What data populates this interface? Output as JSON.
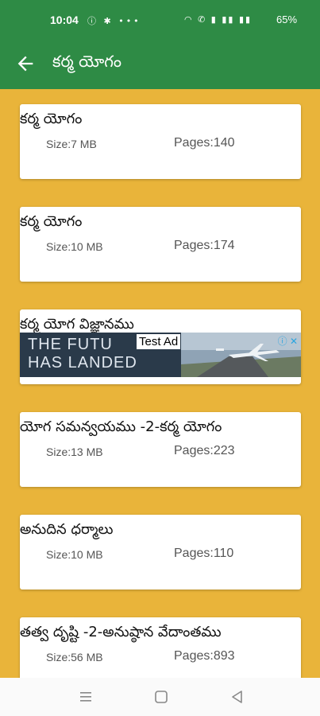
{
  "status": {
    "time": "10:04",
    "left_icons": "ⓘ ✱ •••",
    "right_icons": "◠ ✆ ▮ ▮▮ ▮▮",
    "battery": "65%"
  },
  "header": {
    "title": "కర్మ యోగం",
    "back_icon": "arrow-back-icon"
  },
  "books": [
    {
      "title": "కర్మ యోగం",
      "size": "Size:7 MB",
      "pages": "Pages:140"
    },
    {
      "title": "కర్మ యోగం",
      "size": "Size:10 MB",
      "pages": "Pages:174"
    },
    {
      "title": "కర్మ యోగ విజ్ఞానము"
    },
    {
      "title": "యోగ సమన్వయము -2-కర్మ యోగం",
      "size": "Size:13 MB",
      "pages": "Pages:223"
    },
    {
      "title": "అనుదిన ధర్మాలు",
      "size": "Size:10 MB",
      "pages": "Pages:110"
    },
    {
      "title": "తత్వ దృష్టి -2-అనుష్ఠాన వేదాంతము",
      "size": "Size:56 MB",
      "pages": "Pages:893"
    }
  ],
  "ad": {
    "line1": "THE FUTU",
    "line2": "HAS LANDED",
    "label": "Test Ad",
    "choice": "ⓘ ✕"
  },
  "colors": {
    "appbar": "#2E8B45",
    "background": "#E9B43A"
  }
}
